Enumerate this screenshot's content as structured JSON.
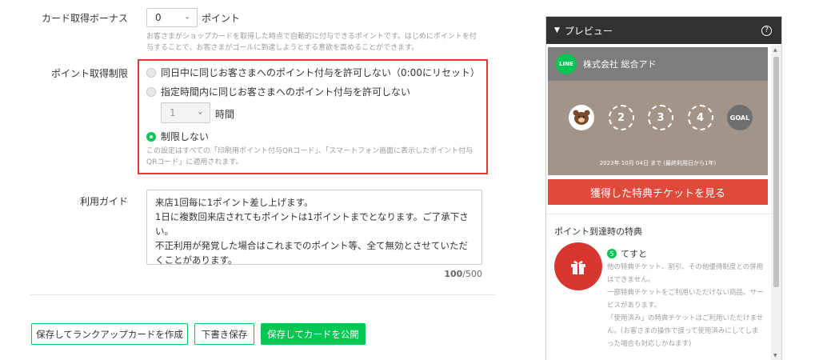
{
  "card_bonus": {
    "label": "カード取得ボーナス",
    "value": "0",
    "unit": "ポイント",
    "help": "お客さまがショップカードを取得した時点で自動的に付与できるポイントです。はじめにポイントを付与することで、お客さまがゴールに到達しようとする意欲を高めることができます。"
  },
  "limit": {
    "label": "ポイント取得制限",
    "option1": "同日中に同じお客さまへのポイント付与を許可しない（0:00にリセット）",
    "option2": "指定時間内に同じお客さまへのポイント付与を許可しない",
    "hours_value": "1",
    "hours_unit": "時間",
    "option3": "制限しない",
    "help": "この設定はすべての「印刷用ポイント付与QRコード」、「スマートフォン画面に表示したポイント付与QRコード」に適用されます。"
  },
  "guide": {
    "label": "利用ガイド",
    "text": "来店1回毎に1ポイント差し上げます。\n1日に複数回来店されてもポイントは1ポイントまでとなります。ご了承下さい。\n不正利用が発覚した場合はこれまでのポイント等、全て無効とさせていただくことがあります。",
    "count": "100",
    "max": "/500"
  },
  "buttons": {
    "save_rankup": "保存してランクアップカードを作成",
    "draft": "下書き保存",
    "publish": "保存してカードを公開"
  },
  "preview": {
    "title": "プレビュー",
    "shop_name": "株式会社 総合アド",
    "logo_text": "LINE",
    "stamps": [
      "2",
      "3",
      "4"
    ],
    "goal": "GOAL",
    "expiry": "2023年 10月 04日 まで (最終利用日から1年)",
    "ticket_button": "獲得した特典チケットを見る",
    "reward_heading": "ポイント到達時の特典",
    "reward_points": "5",
    "reward_name": "てすと",
    "reward_desc": "他の特典チケット、割引、その他優待制度との併用はできません。\n一部特典チケットをご利用いただけない商品、サービスがあります。\n「使用済み」の特典チケットはご利用いただけません。(お客さまの操作で誤って使用済みにしてしまった場合も対応しかねます)"
  },
  "colors": {
    "accent": "#06c755",
    "highlight": "#e53935",
    "ticket": "#e04a3a"
  }
}
